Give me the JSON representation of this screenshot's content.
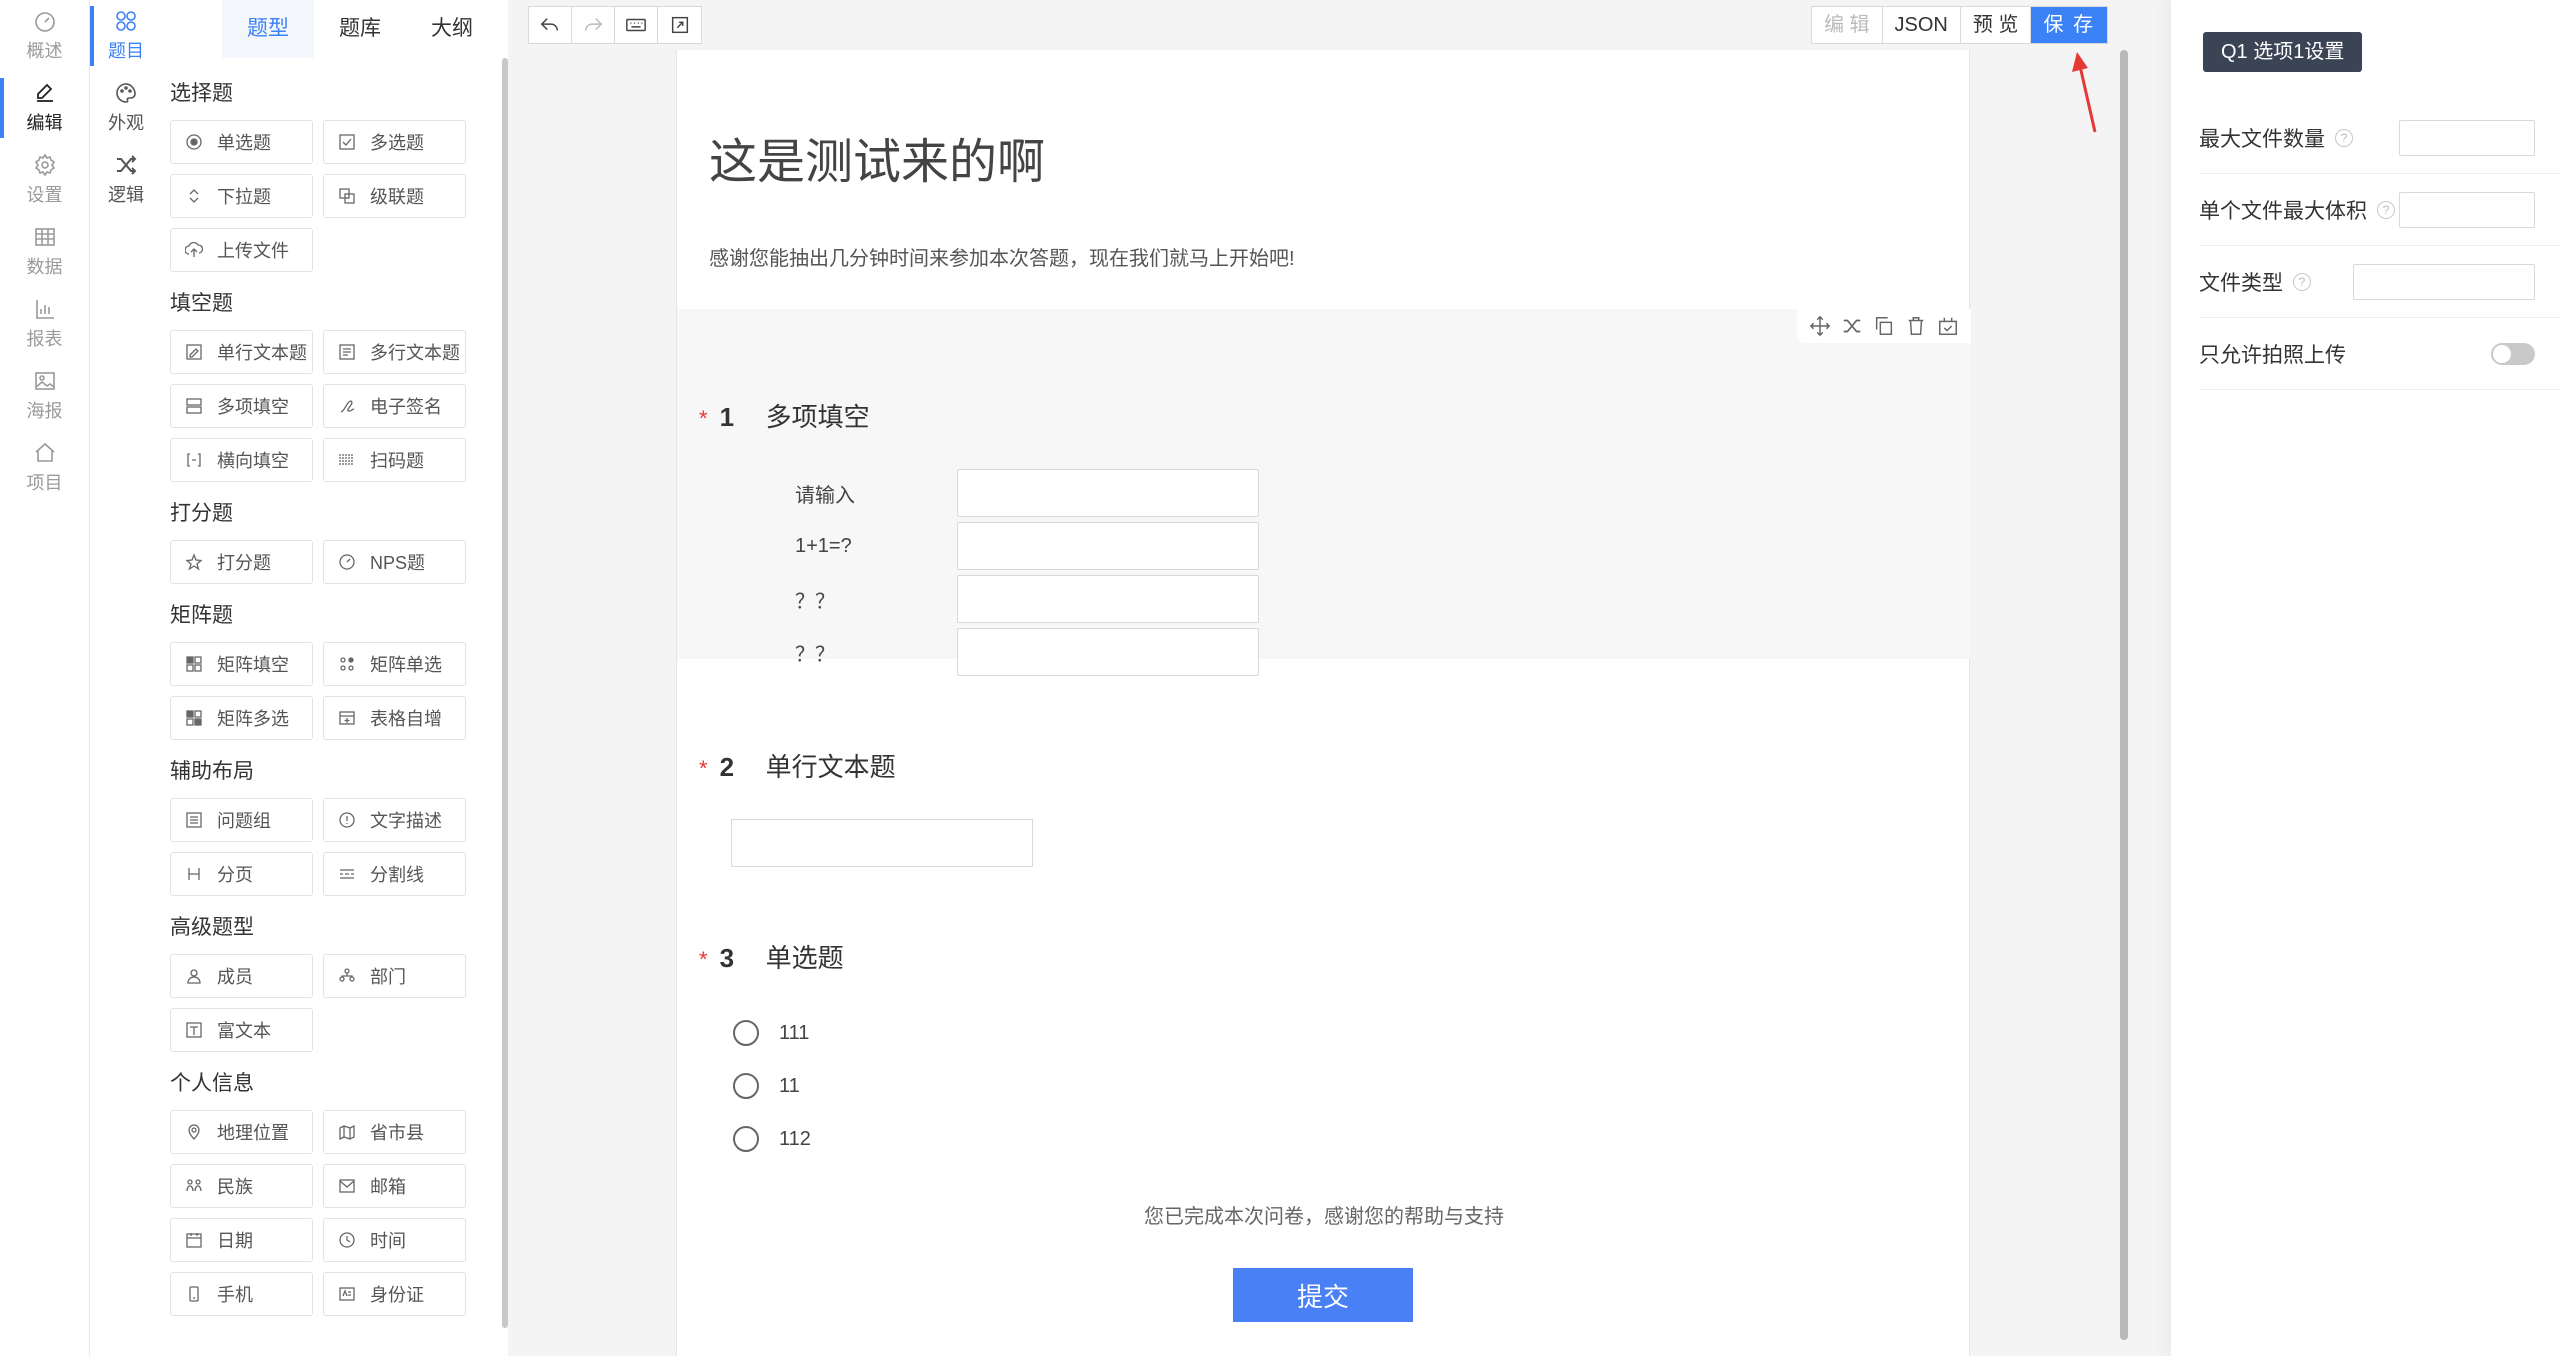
{
  "nav": {
    "items": [
      {
        "label": "概述",
        "icon": "dashboard-icon"
      },
      {
        "label": "编辑",
        "icon": "edit-icon"
      },
      {
        "label": "设置",
        "icon": "gear-icon"
      },
      {
        "label": "数据",
        "icon": "table-icon"
      },
      {
        "label": "报表",
        "icon": "bar-chart-icon"
      },
      {
        "label": "海报",
        "icon": "image-icon"
      },
      {
        "label": "项目",
        "icon": "home-icon"
      }
    ],
    "active": "编辑"
  },
  "subnav": {
    "items": [
      {
        "label": "题目",
        "icon": "grid-icon"
      },
      {
        "label": "外观",
        "icon": "palette-icon"
      },
      {
        "label": "逻辑",
        "icon": "shuffle-icon"
      }
    ],
    "active": "题目"
  },
  "palette": {
    "tabs": [
      "题型",
      "题库",
      "大纲"
    ],
    "active_tab": "题型",
    "groups": [
      {
        "title": "选择题",
        "items": [
          "单选题",
          "多选题",
          "下拉题",
          "级联题",
          "上传文件"
        ]
      },
      {
        "title": "填空题",
        "items": [
          "单行文本题",
          "多行文本题",
          "多项填空",
          "电子签名",
          "横向填空",
          "扫码题"
        ]
      },
      {
        "title": "打分题",
        "items": [
          "打分题",
          "NPS题"
        ]
      },
      {
        "title": "矩阵题",
        "items": [
          "矩阵填空",
          "矩阵单选",
          "矩阵多选",
          "表格自增"
        ]
      },
      {
        "title": "辅助布局",
        "items": [
          "问题组",
          "文字描述",
          "分页",
          "分割线"
        ]
      },
      {
        "title": "高级题型",
        "items": [
          "成员",
          "部门",
          "富文本"
        ]
      },
      {
        "title": "个人信息",
        "items": [
          "地理位置",
          "省市县",
          "民族",
          "邮箱",
          "日期",
          "时间",
          "手机",
          "身份证"
        ]
      }
    ]
  },
  "toolbar": {
    "edit": "编 辑",
    "json": "JSON",
    "preview": "预 览",
    "save": "保 存"
  },
  "survey": {
    "title": "这是测试来的啊",
    "description": "感谢您能抽出几分钟时间来参加本次答题，现在我们就马上开始吧!",
    "questions": [
      {
        "num": "1",
        "required": "*",
        "title": "多项填空",
        "fields": [
          "请输入",
          "1+1=?",
          "？？",
          "？？"
        ]
      },
      {
        "num": "2",
        "required": "*",
        "title": "单行文本题"
      },
      {
        "num": "3",
        "required": "*",
        "title": "单选题",
        "options": [
          "111",
          "11",
          "112"
        ]
      }
    ],
    "finish_text": "您已完成本次问卷，感谢您的帮助与支持",
    "submit_label": "提交"
  },
  "settings": {
    "header": "Q1 选项1设置",
    "rows": [
      {
        "label": "最大文件数量",
        "help": "?"
      },
      {
        "label": "单个文件最大体积",
        "help": "?"
      },
      {
        "label": "文件类型",
        "help": "?"
      },
      {
        "label": "只允许拍照上传"
      }
    ]
  },
  "colors": {
    "accent": "#3b82f6",
    "required": "#e53935",
    "arrow": "#e53935"
  }
}
